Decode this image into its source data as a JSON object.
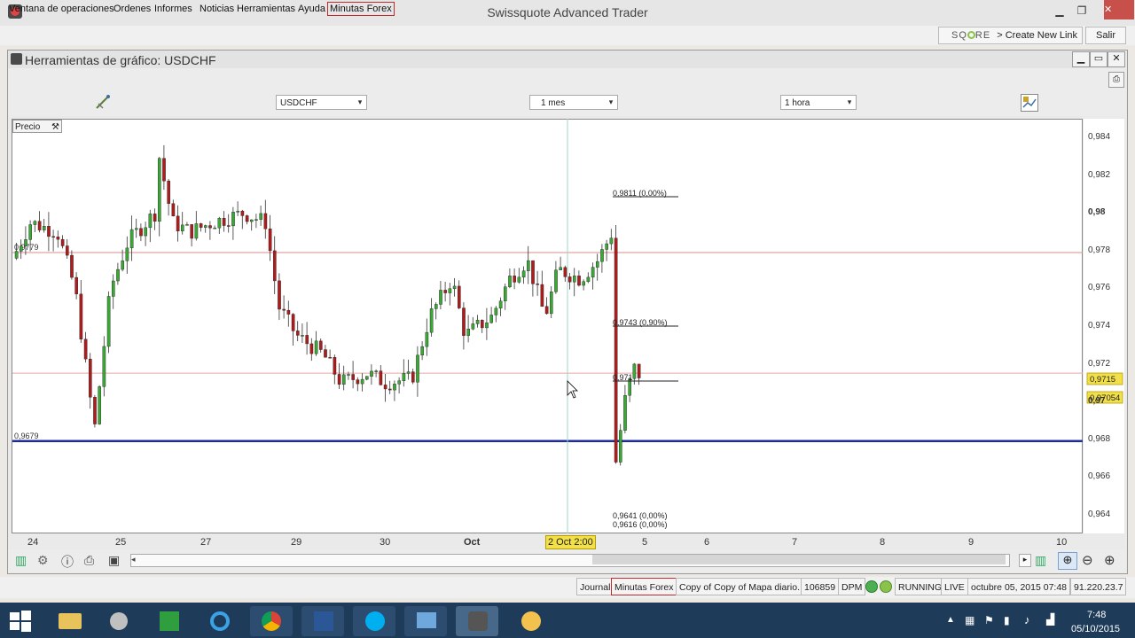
{
  "app": {
    "title": "Swissquote Advanced Trader"
  },
  "menu": {
    "items": [
      "Ventana de operaciones",
      "Ordenes",
      "Informes",
      "Noticias",
      "Herramientas",
      "Ayuda"
    ],
    "highlighted": "Minutas Forex"
  },
  "header": {
    "link_brand": "SQ",
    "link_brand_rest": "RE",
    "link_text": "> Create New Link",
    "salir": "Salir"
  },
  "chart_window": {
    "title": "Herramientas de gráfico: USDCHF",
    "symbol": "USDCHF",
    "range": "1 mes",
    "interval": "1 hora",
    "price_label": "Precio"
  },
  "chart_data": {
    "type": "candlestick",
    "symbol": "USDCHF",
    "x_ticks": [
      "24",
      "25",
      "27",
      "29",
      "30",
      "Oct",
      "5",
      "6",
      "7",
      "8",
      "9",
      "10"
    ],
    "crosshair_x_label": "2 Oct 2:00",
    "y_ticks": [
      "0,984",
      "0,982",
      "0,98",
      "0,978",
      "0,976",
      "0,974",
      "0,972",
      "0,97",
      "0,968",
      "0,966",
      "0,964"
    ],
    "ylim": [
      0.963,
      0.985
    ],
    "horizontal_lines": [
      {
        "label": "0,9779",
        "value": 0.9779,
        "color": "#d98b8b"
      },
      {
        "label": "0,9679",
        "value": 0.9679,
        "color": "#1b2a9c"
      },
      {
        "label": "",
        "value": 0.9715,
        "color": "#e6a8a8"
      }
    ],
    "fib_labels": [
      "0,9811 (0,00%)",
      "0,9743 (0,90%)",
      "0,971",
      "0,9641 (0,00%)",
      "0,9616 (0,00%)"
    ],
    "price_badges": [
      "0,9715",
      "0,97054"
    ]
  },
  "status": {
    "items": [
      "Journal",
      "Minutas Forex",
      "Copy of Copy of Mapa diario.",
      "106859",
      "DPM",
      "RUNNING",
      "LIVE",
      "octubre 05, 2015 07:48",
      "91.220.23.7"
    ]
  },
  "taskbar": {
    "time": "7:48",
    "date": "05/10/2015"
  }
}
